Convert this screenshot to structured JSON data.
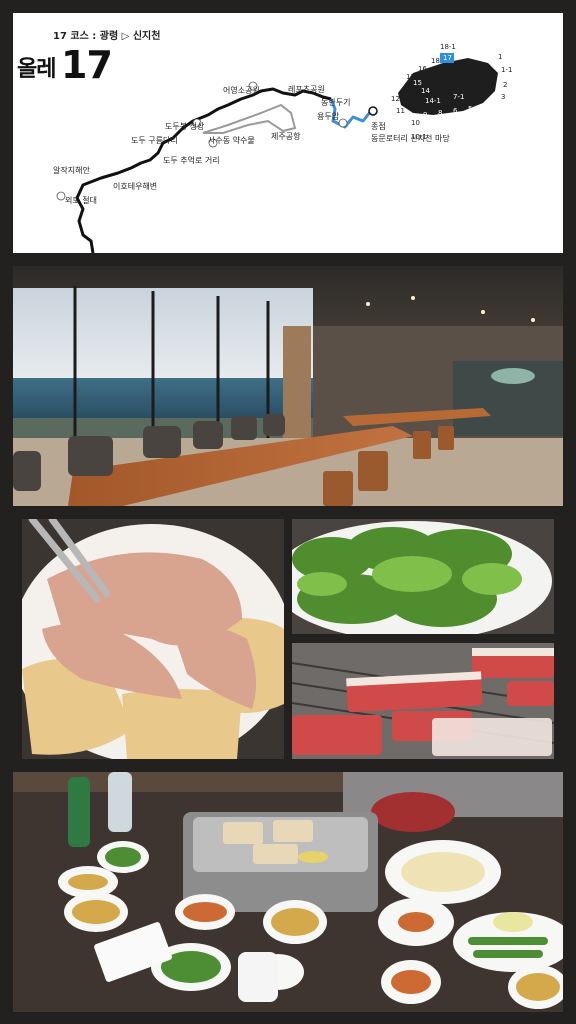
{
  "map": {
    "course_label": "17 코스 : 광령 ▷ 신지천",
    "title_word": "올레",
    "title_number": "17",
    "pois": {
      "oreum": "어영소공원",
      "leports": "레포츠공원",
      "dongmun": "동한두기",
      "dumaek": "도두봉 정상",
      "guru": "도두 구름다리",
      "sasu": "사수동 약수물",
      "jeju_airport": "제주공항",
      "dodu_street": "도두 추억로 거리",
      "yongdu": "용두암",
      "end": "종점",
      "end_desc": "동문로터리 산지천 마당",
      "ilwol": "알작지해안",
      "ihotebu": "이호테우해변",
      "oedo": "외도 절대"
    },
    "island_numbers": [
      "18-1",
      "17",
      "1",
      "1-1",
      "2",
      "3",
      "4",
      "5",
      "6",
      "7",
      "7-1",
      "8",
      "9",
      "10",
      "10-1",
      "11",
      "12",
      "13",
      "14",
      "14-1",
      "15",
      "16",
      "18"
    ]
  },
  "colors": {
    "route": "#111111",
    "route_highlight": "#3b8fd9",
    "island": "#1e1e1e",
    "island_highlight": "#2f8fe0"
  }
}
